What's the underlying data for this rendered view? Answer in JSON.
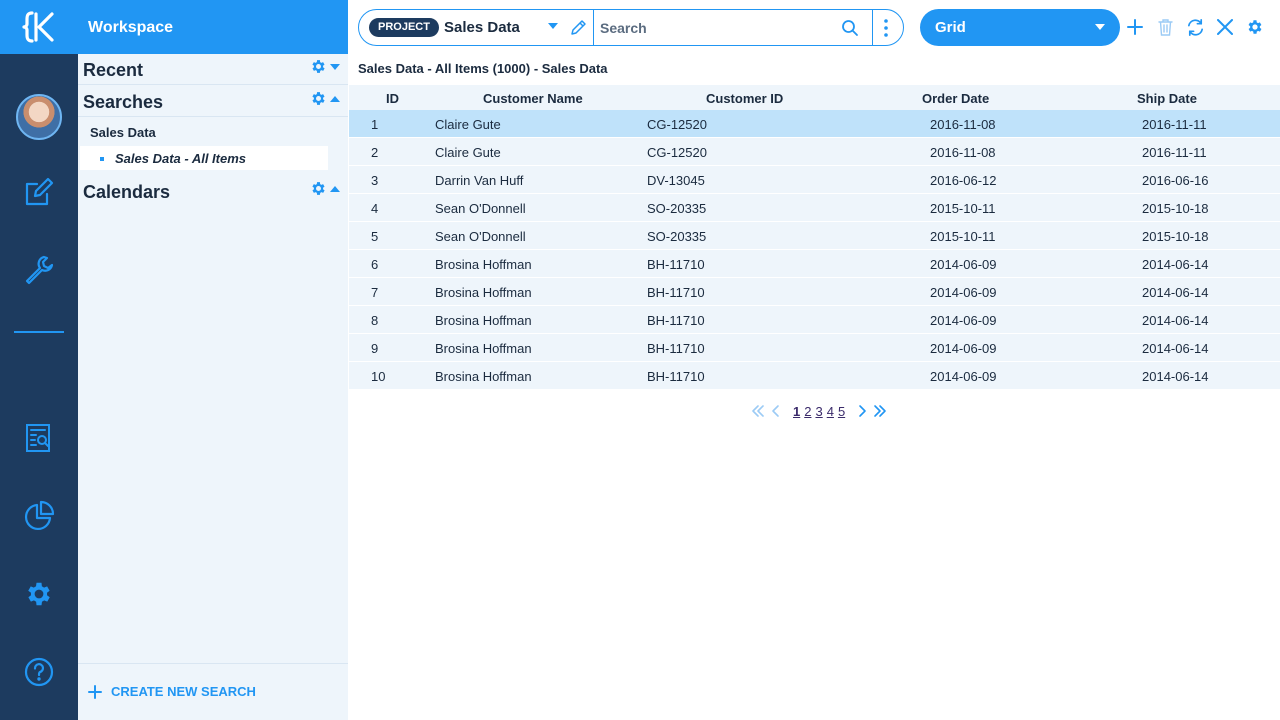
{
  "workspace": {
    "title": "Workspace"
  },
  "sections": {
    "recent": "Recent",
    "searches": "Searches",
    "calendars": "Calendars",
    "tree_parent": "Sales Data",
    "tree_child": "Sales Data - All Items"
  },
  "create_new_search": "CREATE NEW SEARCH",
  "toolbar": {
    "project_badge": "PROJECT",
    "project_name": "Sales Data",
    "search_placeholder": "Search",
    "view_name": "Grid"
  },
  "breadcrumb": "Sales Data - All Items (1000) - Sales Data",
  "table": {
    "headers": [
      "ID",
      "Customer Name",
      "Customer ID",
      "Order Date",
      "Ship Date"
    ],
    "rows": [
      [
        "1",
        "Claire Gute",
        "CG-12520",
        "2016-11-08",
        "2016-11-11"
      ],
      [
        "2",
        "Claire Gute",
        "CG-12520",
        "2016-11-08",
        "2016-11-11"
      ],
      [
        "3",
        "Darrin Van Huff",
        "DV-13045",
        "2016-06-12",
        "2016-06-16"
      ],
      [
        "4",
        "Sean O'Donnell",
        "SO-20335",
        "2015-10-11",
        "2015-10-18"
      ],
      [
        "5",
        "Sean O'Donnell",
        "SO-20335",
        "2015-10-11",
        "2015-10-18"
      ],
      [
        "6",
        "Brosina Hoffman",
        "BH-11710",
        "2014-06-09",
        "2014-06-14"
      ],
      [
        "7",
        "Brosina Hoffman",
        "BH-11710",
        "2014-06-09",
        "2014-06-14"
      ],
      [
        "8",
        "Brosina Hoffman",
        "BH-11710",
        "2014-06-09",
        "2014-06-14"
      ],
      [
        "9",
        "Brosina Hoffman",
        "BH-11710",
        "2014-06-09",
        "2014-06-14"
      ],
      [
        "10",
        "Brosina Hoffman",
        "BH-11710",
        "2014-06-09",
        "2014-06-14"
      ]
    ],
    "selected_row": 0
  },
  "pagination": {
    "pages": [
      "1",
      "2",
      "3",
      "4",
      "5"
    ],
    "current": "1"
  },
  "colors": {
    "accent": "#2196f3",
    "rail": "#1d3b5f",
    "panel": "#eef5fb",
    "selected_row": "#bfe2fa"
  },
  "icons": [
    "logo-icon",
    "avatar",
    "edit-icon",
    "wrench-icon",
    "report-search-icon",
    "pie-chart-icon",
    "gear-icon",
    "help-icon",
    "pencil-icon",
    "search-icon",
    "kebab-icon",
    "plus-icon",
    "trash-icon",
    "refresh-icon",
    "close-icon"
  ]
}
